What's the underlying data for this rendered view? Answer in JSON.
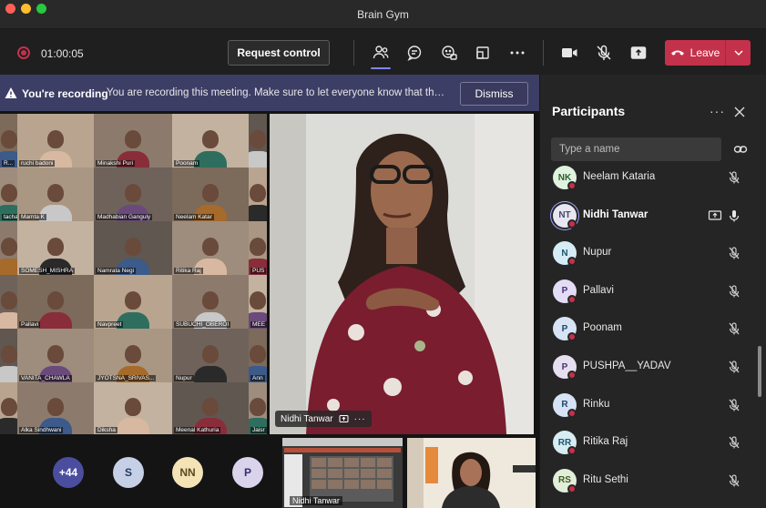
{
  "window": {
    "title": "Brain Gym"
  },
  "toolbar": {
    "timer": "01:00:05",
    "request_control": "Request control",
    "leave": "Leave"
  },
  "banner": {
    "title": "You're recording",
    "text": "You are recording this meeting. Make sure to let everyone know that they a...",
    "dismiss": "Dismiss"
  },
  "grid_names": [
    [
      "R...",
      "ruchi badoni",
      "Minakshi Puri",
      "Poonam",
      ""
    ],
    [
      "tacharya",
      "Mamta K",
      "Madhabian Ganguly",
      "Neelam Katar",
      ""
    ],
    [
      "",
      "SOMESH_MISHRA",
      "Namrata Negi",
      "Ritika Raj",
      "PUS"
    ],
    [
      "",
      "Pallavi",
      "Navpreet",
      "SUBUCHI_OBEROI",
      "MEE"
    ],
    [
      "",
      "VANITA_CHAWLA",
      "JYOTSNA_SRIVAS...",
      "Nupur",
      "Ann"
    ],
    [
      "",
      "Alka Sindhwani",
      "Diksha",
      "Meenal Kathuria",
      "Jaisr"
    ]
  ],
  "speaker": {
    "name": "Nidhi Tanwar"
  },
  "bottom_avatars": [
    {
      "initials": "+44",
      "bg": "#4b4e9e",
      "fg": "#ffffff"
    },
    {
      "initials": "S",
      "bg": "#c5d0e6",
      "fg": "#243a5e"
    },
    {
      "initials": "NN",
      "bg": "#f3e3b5",
      "fg": "#5a4a1e"
    },
    {
      "initials": "P",
      "bg": "#d9d3ec",
      "fg": "#3b2e6e"
    }
  ],
  "thumb_name": "Nidhi Tanwar",
  "participants_panel": {
    "title": "Participants",
    "search_placeholder": "Type a name",
    "participants": [
      {
        "initials": "NK",
        "name": "Neelam Kataria",
        "bg": "#dff3df",
        "fg": "#2c5e2c",
        "muted": true,
        "bold": false,
        "sharing": false
      },
      {
        "initials": "NT",
        "name": "Nidhi Tanwar",
        "bg": "#e8e6f0",
        "fg": "#4a4a6a",
        "muted": false,
        "bold": true,
        "sharing": true
      },
      {
        "initials": "N",
        "name": "Nupur",
        "bg": "#d6ecf5",
        "fg": "#1f5670",
        "muted": true,
        "bold": false,
        "sharing": false
      },
      {
        "initials": "P",
        "name": "Pallavi",
        "bg": "#e3dcf5",
        "fg": "#48307a",
        "muted": true,
        "bold": false,
        "sharing": false
      },
      {
        "initials": "P",
        "name": "Poonam",
        "bg": "#d6e4f5",
        "fg": "#23466e",
        "muted": true,
        "bold": false,
        "sharing": false
      },
      {
        "initials": "P",
        "name": "PUSHPA__YADAV",
        "bg": "#e6dff0",
        "fg": "#4a3670",
        "muted": true,
        "bold": false,
        "sharing": false
      },
      {
        "initials": "R",
        "name": "Rinku",
        "bg": "#d5e3f5",
        "fg": "#23466e",
        "muted": true,
        "bold": false,
        "sharing": false
      },
      {
        "initials": "RR",
        "name": "Ritika Raj",
        "bg": "#d7ecf3",
        "fg": "#1f5670",
        "muted": true,
        "bold": false,
        "sharing": false
      },
      {
        "initials": "RS",
        "name": "Ritu Sethi",
        "bg": "#e2eed8",
        "fg": "#3e5a25",
        "muted": true,
        "bold": false,
        "sharing": false
      }
    ]
  }
}
